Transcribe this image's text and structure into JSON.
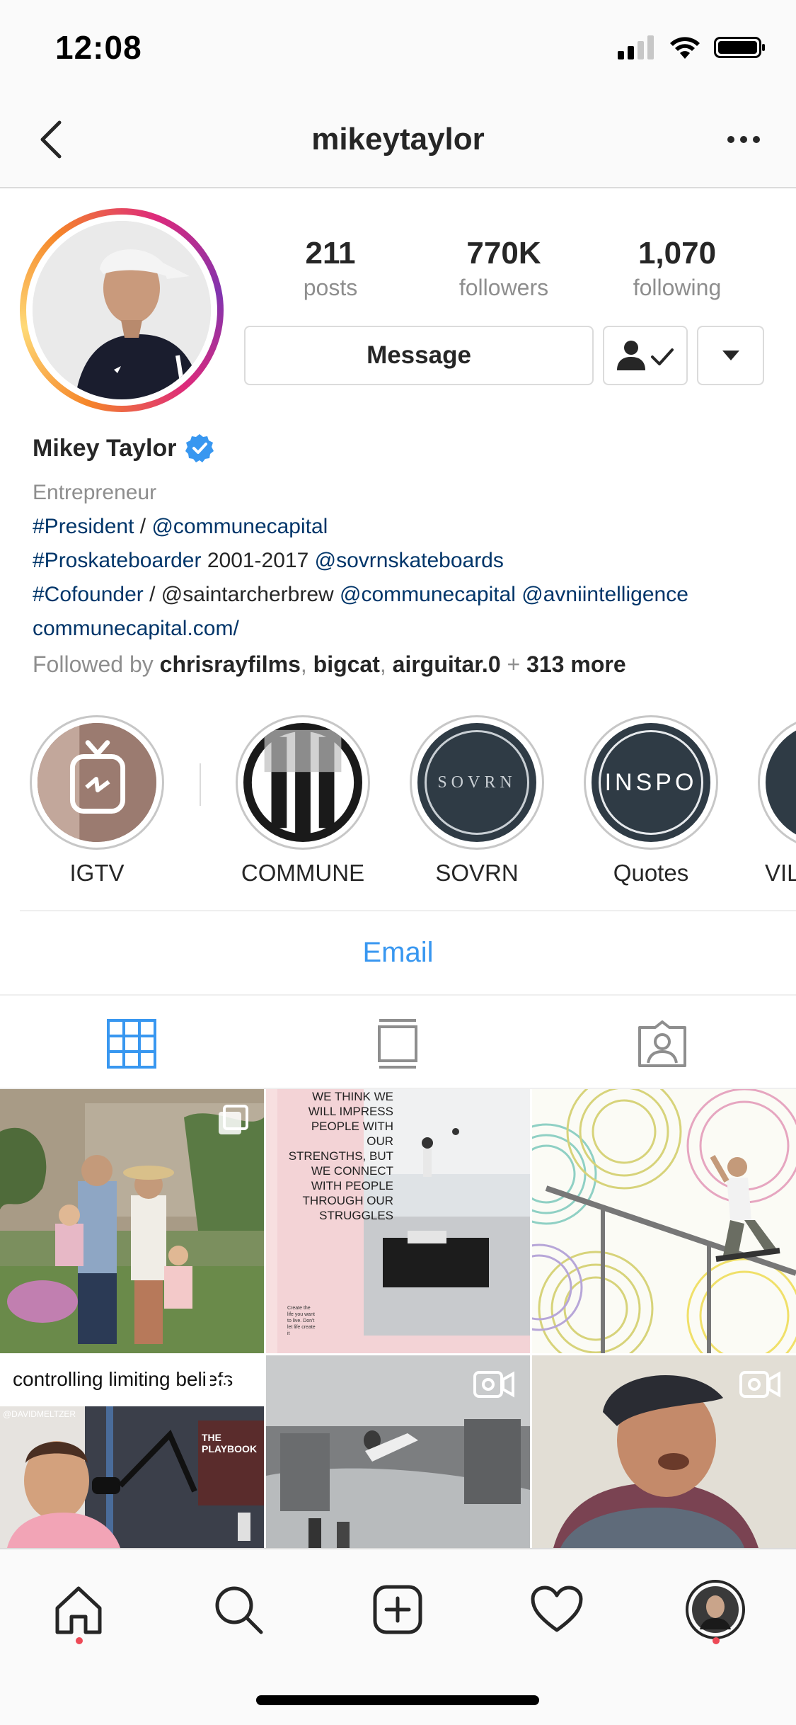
{
  "status_bar": {
    "time": "12:08"
  },
  "header": {
    "username": "mikeytaylor"
  },
  "profile": {
    "stats": [
      {
        "value": "211",
        "label": "posts"
      },
      {
        "value": "770K",
        "label": "followers"
      },
      {
        "value": "1,070",
        "label": "following"
      }
    ],
    "message_label": "Message",
    "full_name": "Mikey Taylor",
    "category": "Entrepreneur",
    "bio": {
      "line1_tag": "#President",
      "line1_sep": " / ",
      "line1_mention": "@communecapital",
      "line2_tag": "#Proskateboarder",
      "line2_text": " 2001-2017 ",
      "line2_mention": "@sovrnskateboards",
      "line3_tag": "#Cofounder",
      "line3_text": " / @saintarcherbrew ",
      "line3_mention1": "@communecapital",
      "line3_mention2": "@avniintelligence",
      "website": "communecapital.com/"
    },
    "followed_by": {
      "prefix": "Followed by ",
      "user1": "chrisrayfilms",
      "user2": "bigcat",
      "user3": "airguitar.0",
      "sep": ", ",
      "plus": " + ",
      "more": "313 more"
    }
  },
  "highlights": [
    {
      "label": "IGTV"
    },
    {
      "label": "COMMUNE"
    },
    {
      "label": "SOVRN",
      "image_text": "SOVRN"
    },
    {
      "label": "Quotes",
      "image_text": "INSPO"
    },
    {
      "label": "VILLA"
    }
  ],
  "email_label": "Email",
  "grid": {
    "post2_text": "WE THINK WE WILL IMPRESS PEOPLE WITH OUR STRENGTHS, BUT WE CONNECT WITH PEOPLE THROUGH OUR STRUGGLES",
    "post2_small": "Create the life you want to live. Don't let life create it",
    "post4_caption": "controlling limiting beliefs",
    "post4_tag": "@DAVIDMELTZER",
    "post4_sign": "THE PLAYBOOK"
  },
  "colors": {
    "accent": "#3897f0",
    "link": "#003569",
    "notification": "#ed4956"
  }
}
